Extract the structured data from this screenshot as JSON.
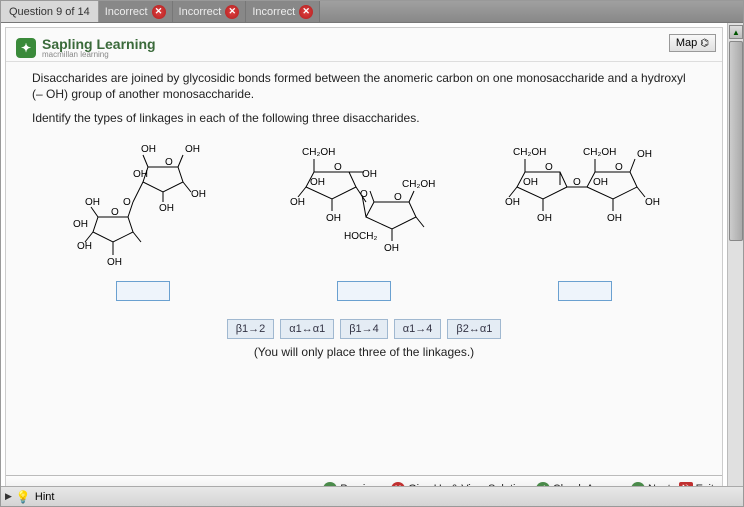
{
  "topbar": {
    "question_label": "Question 9 of 14",
    "incorrect_tabs": [
      "Incorrect",
      "Incorrect",
      "Incorrect"
    ]
  },
  "map_button": "Map",
  "brand": {
    "title": "Sapling Learning",
    "subtitle": "macmillan learning",
    "logo_symbol": "✦"
  },
  "question": {
    "para1": "Disaccharides are joined by glycosidic bonds formed between the anomeric carbon on one monosaccharide and a hydroxyl (– OH) group of another monosaccharide.",
    "para2": "Identify the types of linkages in each of the following three disaccharides."
  },
  "diagrams": {
    "labels": {
      "OH": "OH",
      "CH2OH": "CH₂OH",
      "HOCH2": "HOCH₂",
      "O": "O"
    }
  },
  "tiles": [
    "β1→2",
    "α1↔α1",
    "β1→4",
    "α1→4",
    "β2↔α1"
  ],
  "tiles_note": "(You will only place three of the linkages.)",
  "toolbar": {
    "previous": "Previous",
    "giveup": "Give Up & View Solution",
    "check": "Check Answer",
    "next": "Next",
    "exit": "Exit"
  },
  "hint": {
    "label": "Hint",
    "arrow": "▶"
  }
}
